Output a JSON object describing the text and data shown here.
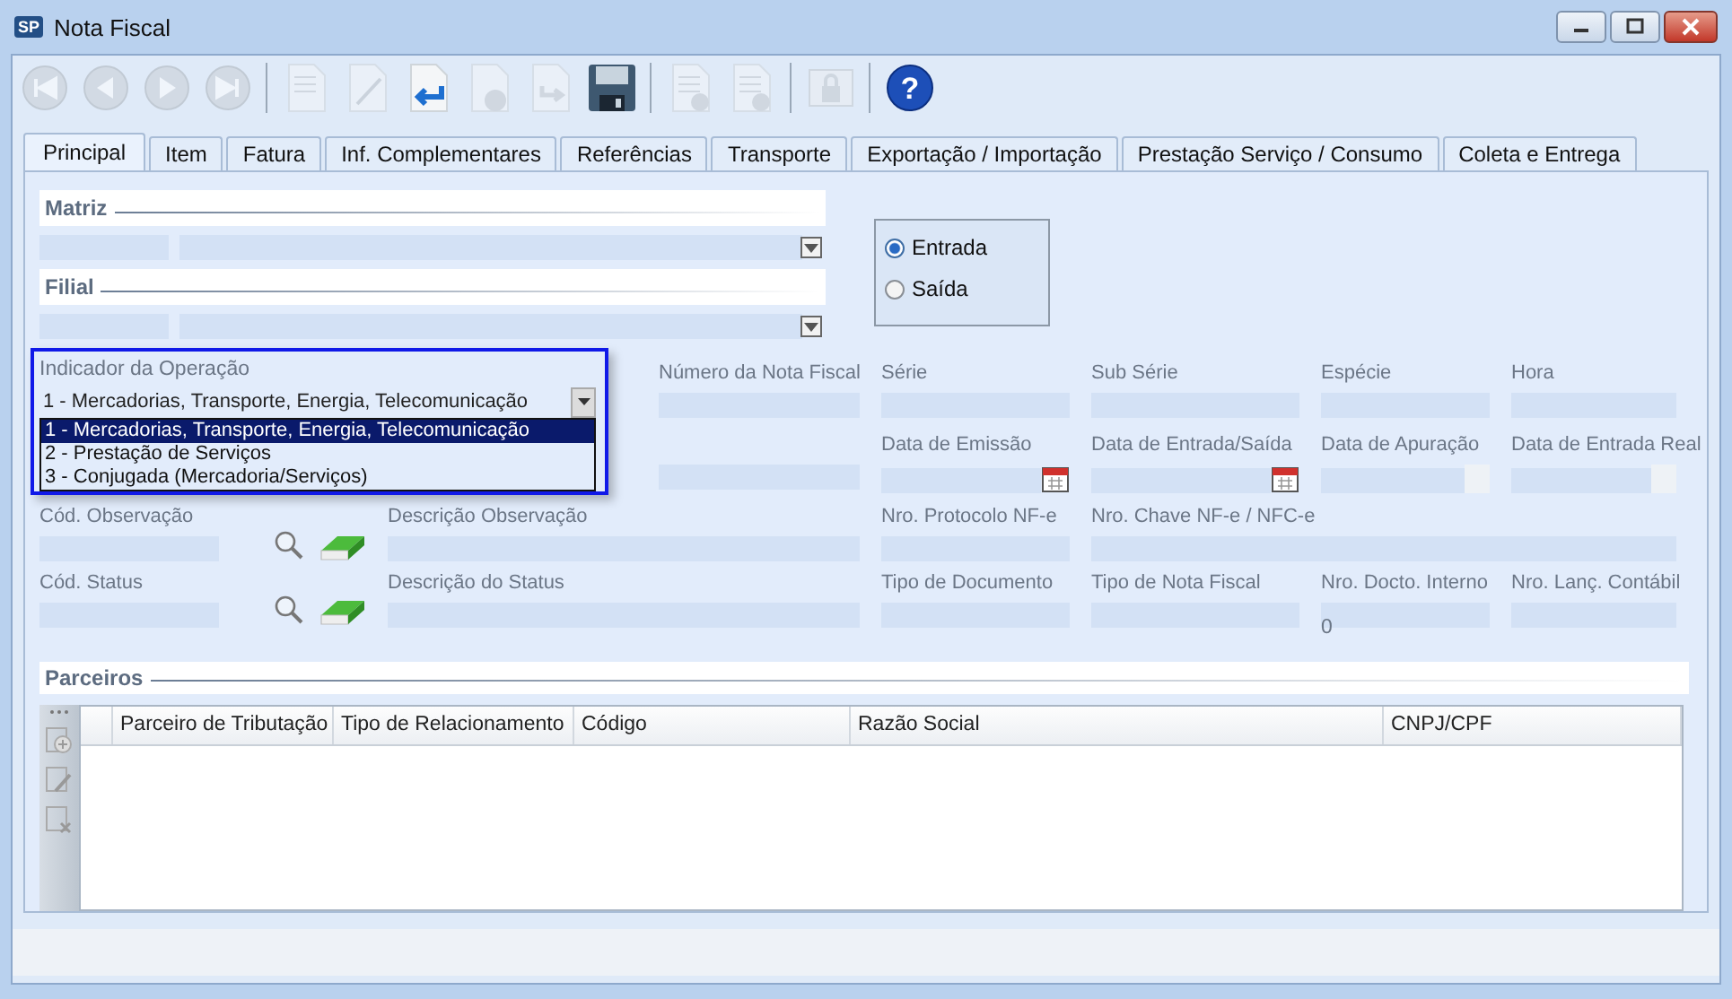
{
  "window": {
    "title": "Nota Fiscal",
    "app_badge": "SP"
  },
  "toolbar": [
    [
      {
        "kind": "first",
        "disabled": true
      },
      {
        "kind": "prev",
        "disabled": true
      },
      {
        "kind": "next",
        "disabled": true
      },
      {
        "kind": "last",
        "disabled": true
      }
    ],
    [
      {
        "kind": "new",
        "disabled": true
      },
      {
        "kind": "edit",
        "disabled": true
      },
      {
        "kind": "undo",
        "disabled": false
      },
      {
        "kind": "cancel",
        "disabled": true
      },
      {
        "kind": "forward",
        "disabled": true
      },
      {
        "kind": "save",
        "disabled": false
      }
    ],
    [
      {
        "kind": "report",
        "disabled": true
      },
      {
        "kind": "sum",
        "disabled": true
      }
    ],
    [
      {
        "kind": "lock",
        "disabled": true
      }
    ],
    [
      {
        "kind": "help",
        "disabled": false,
        "glyph": "?"
      }
    ]
  ],
  "tabs": [
    {
      "label": "Principal",
      "selected": true
    },
    {
      "label": "Item",
      "selected": false
    },
    {
      "label": "Fatura",
      "selected": false
    },
    {
      "label": "Inf. Complementares",
      "selected": false
    },
    {
      "label": "Referências",
      "selected": false
    },
    {
      "label": "Transporte",
      "selected": false
    },
    {
      "label": "Exportação / Importação",
      "selected": false
    },
    {
      "label": "Prestação Serviço / Consumo",
      "selected": false
    },
    {
      "label": "Coleta e Entrega",
      "selected": false
    }
  ],
  "matriz": {
    "title": "Matriz"
  },
  "filial": {
    "title": "Filial"
  },
  "direction": {
    "options": [
      {
        "label": "Entrada",
        "selected": true
      },
      {
        "label": "Saída",
        "selected": false
      }
    ]
  },
  "operation_indicator": {
    "label": "Indicador da Operação",
    "value": "1 - Mercadorias, Transporte, Energia, Telecomunicação",
    "expanded": true,
    "options": [
      {
        "label": "1 - Mercadorias, Transporte, Energia, Telecomunicação",
        "selected": true
      },
      {
        "label": "2 - Prestação de Serviços",
        "selected": false
      },
      {
        "label": "3 - Conjugada (Mercadoria/Serviços)",
        "selected": false
      }
    ]
  },
  "fields": {
    "numero_nf": {
      "label": "Número da Nota Fiscal"
    },
    "serie": {
      "label": "Série"
    },
    "sub_serie": {
      "label": "Sub Série"
    },
    "especie": {
      "label": "Espécie"
    },
    "hora": {
      "label": "Hora"
    },
    "data_emissao": {
      "label": "Data de Emissão"
    },
    "data_entrada_saida": {
      "label": "Data de Entrada/Saída"
    },
    "data_apuracao": {
      "label": "Data de Apuração"
    },
    "data_entrada_real": {
      "label": "Data de Entrada Real"
    },
    "cod_observacao": {
      "label": "Cód. Observação"
    },
    "descricao_observacao": {
      "label": "Descrição Observação"
    },
    "protocolo": {
      "label": "Nro. Protocolo NF-e"
    },
    "chave": {
      "label": "Nro. Chave NF-e / NFC-e"
    },
    "cod_status": {
      "label": "Cód. Status"
    },
    "descricao_status": {
      "label": "Descrição do Status"
    },
    "tipo_documento": {
      "label": "Tipo de Documento"
    },
    "tipo_nota": {
      "label": "Tipo de Nota Fiscal"
    },
    "docto_interno": {
      "label": "Nro. Docto. Interno",
      "value": "0"
    },
    "lanc_contabil": {
      "label": "Nro. Lanç. Contábil"
    }
  },
  "parceiros": {
    "title": "Parceiros",
    "columns": [
      "Parceiro de Tributação",
      "Tipo de Relacionamento",
      "Código",
      "Razão Social",
      "CNPJ/CPF"
    ]
  }
}
